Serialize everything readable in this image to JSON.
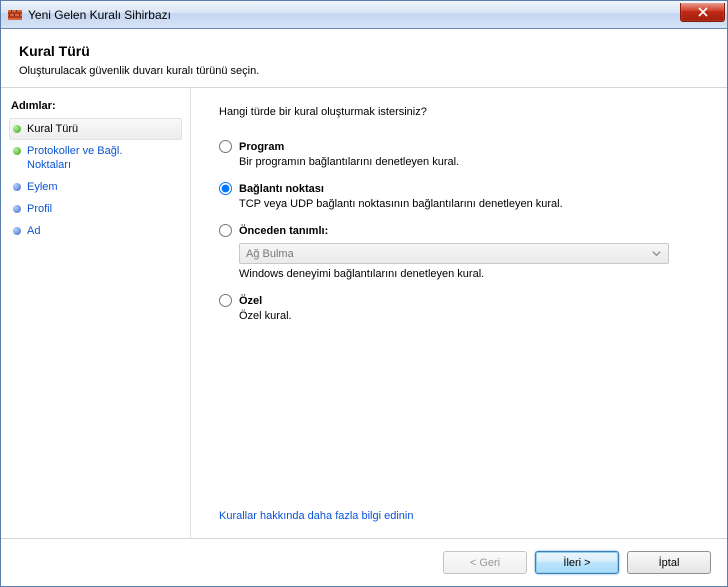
{
  "window": {
    "title": "Yeni Gelen Kuralı Sihirbazı"
  },
  "header": {
    "title": "Kural Türü",
    "subtitle": "Oluşturulacak güvenlik duvarı kuralı türünü seçin."
  },
  "sidebar": {
    "title": "Adımlar:",
    "steps": [
      {
        "label": "Kural Türü"
      },
      {
        "label": "Protokoller ve Bağl. Noktaları"
      },
      {
        "label": "Eylem"
      },
      {
        "label": "Profil"
      },
      {
        "label": "Ad"
      }
    ]
  },
  "main": {
    "prompt": "Hangi türde bir kural oluşturmak istersiniz?",
    "options": {
      "program": {
        "label": "Program",
        "desc": "Bir programın bağlantılarını denetleyen kural."
      },
      "port": {
        "label": "Bağlantı noktası",
        "desc": "TCP veya UDP bağlantı noktasının bağlantılarını denetleyen kural."
      },
      "predefined": {
        "label": "Önceden tanımlı:",
        "desc": "Windows deneyimi bağlantılarını denetleyen kural.",
        "select_value": "Ağ Bulma"
      },
      "custom": {
        "label": "Özel",
        "desc": "Özel kural."
      }
    },
    "learn_more": "Kurallar hakkında daha fazla bilgi edinin"
  },
  "footer": {
    "back": "< Geri",
    "next": "İleri >",
    "cancel": "İptal"
  }
}
